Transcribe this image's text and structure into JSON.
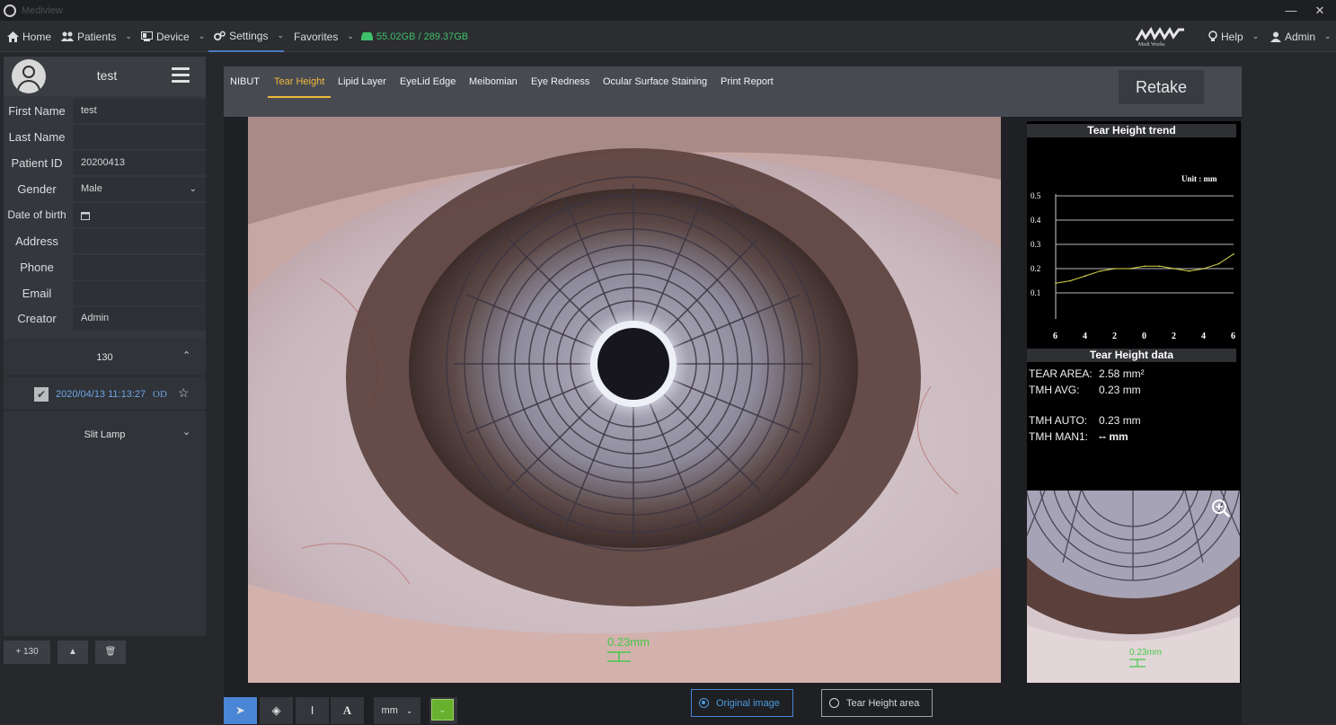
{
  "window": {
    "title": "Mediview",
    "minimize": "—",
    "close": "✕"
  },
  "menu": {
    "home": "Home",
    "patients": "Patients",
    "device": "Device",
    "settings": "Settings",
    "favorites": "Favorites",
    "storage": "55.02GB / 289.37GB",
    "brand": "Medi Works",
    "help": "Help",
    "admin": "Admin"
  },
  "user": {
    "name": "test"
  },
  "patient_fields": [
    {
      "label": "First Name",
      "value": "test"
    },
    {
      "label": "Last Name",
      "value": ""
    },
    {
      "label": "Patient ID",
      "value": "20200413"
    },
    {
      "label": "Gender",
      "value": "Male"
    },
    {
      "label": "Date of birth",
      "value": ""
    },
    {
      "label": "Address",
      "value": ""
    },
    {
      "label": "Phone",
      "value": ""
    },
    {
      "label": "Email",
      "value": ""
    },
    {
      "label": "Creator",
      "value": "Admin"
    }
  ],
  "records": {
    "group_label": "130",
    "item_date": "2020/04/13 11:13:27",
    "item_eye": "OD",
    "slit_lamp": "Slit Lamp"
  },
  "bottom_buttons": {
    "add_label": "+ 130"
  },
  "tabs": [
    "NIBUT",
    "Tear Height",
    "Lipid Layer",
    "EyeLid Edge",
    "Meibomian",
    "Eye Redness",
    "Ocular Surface Staining",
    "Print Report"
  ],
  "active_tab": "Tear Height",
  "retake_label": "Retake",
  "measure_label": "0.23mm",
  "thumb_measure_label": "0.23mm",
  "trend": {
    "title": "Tear Height trend",
    "unit": "Unit : mm"
  },
  "chart_data": {
    "type": "line",
    "title": "Tear Height trend",
    "unit": "Unit : mm",
    "x_ticks": [
      "6",
      "4",
      "2",
      "0",
      "2",
      "4",
      "6"
    ],
    "y_ticks": [
      "0.1",
      "0.2",
      "0.3",
      "0.4",
      "0.5"
    ],
    "ylim": [
      0,
      0.5
    ],
    "x": [
      -6,
      -5,
      -4,
      -3,
      -2,
      -1,
      0,
      1,
      2,
      3,
      4,
      5,
      6
    ],
    "y": [
      0.14,
      0.15,
      0.17,
      0.19,
      0.2,
      0.2,
      0.21,
      0.21,
      0.2,
      0.19,
      0.2,
      0.22,
      0.26
    ],
    "line_color": "#d6d84c"
  },
  "tear_data": {
    "title": "Tear Height data",
    "rows": [
      {
        "label": "TEAR AREA:",
        "value": "2.58 mm²"
      },
      {
        "label": "TMH AVG:",
        "value": "0.23 mm"
      },
      {
        "label": "TMH AUTO:",
        "value": "0.23 mm"
      },
      {
        "label": "TMH MAN1:",
        "value": "-- mm"
      }
    ]
  },
  "toolbar": {
    "unit": "mm",
    "original_image": "Original image",
    "tear_height_area": "Tear Height area"
  },
  "colors": {
    "accent": "#f0b83c",
    "select_blue": "#4a85d6",
    "storage_green": "#3fbf6a",
    "measure_green": "#46c84a"
  }
}
